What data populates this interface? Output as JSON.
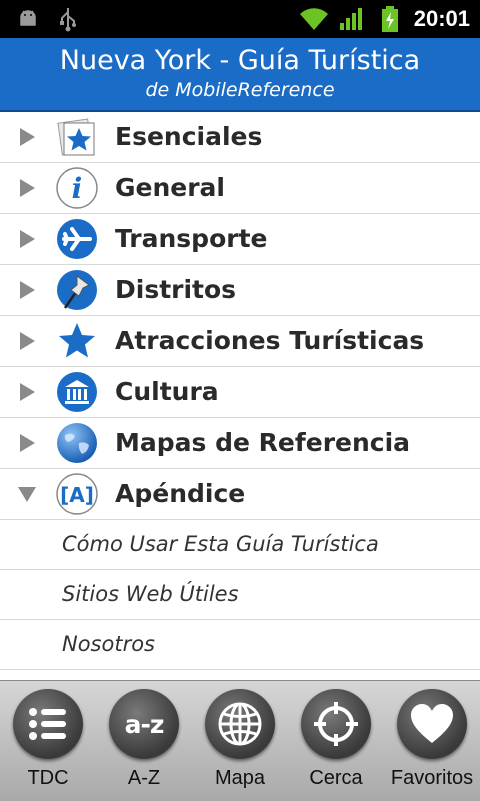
{
  "status_bar": {
    "time": "20:01",
    "icons": [
      "android-debug-icon",
      "usb-icon",
      "wifi-icon",
      "signal-icon",
      "battery-charging-icon"
    ]
  },
  "header": {
    "title": "Nueva York - Guía Turística",
    "subtitle": "de MobileReference"
  },
  "menu": [
    {
      "label": "Esenciales",
      "icon": "essentials-star-icon",
      "expanded": false
    },
    {
      "label": "General",
      "icon": "info-icon",
      "expanded": false
    },
    {
      "label": "Transporte",
      "icon": "airplane-icon",
      "expanded": false
    },
    {
      "label": "Distritos",
      "icon": "pushpin-icon",
      "expanded": false
    },
    {
      "label": "Atracciones Turísticas",
      "icon": "star-icon",
      "expanded": false
    },
    {
      "label": "Cultura",
      "icon": "museum-icon",
      "expanded": false
    },
    {
      "label": "Mapas de Referencia",
      "icon": "globe-icon",
      "expanded": false
    },
    {
      "label": "Apéndice",
      "icon": "appendix-icon",
      "icon_text": "[A]",
      "expanded": true
    }
  ],
  "submenu": [
    {
      "label": "Cómo Usar Esta Guía Turística"
    },
    {
      "label": "Sitios Web Útiles"
    },
    {
      "label": "Nosotros"
    }
  ],
  "toolbar": [
    {
      "label": "TDC",
      "icon": "list-icon"
    },
    {
      "label": "A-Z",
      "icon": "az-icon",
      "icon_text": "a-z"
    },
    {
      "label": "Mapa",
      "icon": "globe-wire-icon"
    },
    {
      "label": "Cerca",
      "icon": "crosshair-icon"
    },
    {
      "label": "Favoritos",
      "icon": "heart-icon"
    }
  ],
  "colors": {
    "header_bg": "#1a6cc6",
    "accent_blue": "#1a6cc6",
    "status_bar_bg": "#000000",
    "toolbar_bg": "#bdbdbd"
  }
}
